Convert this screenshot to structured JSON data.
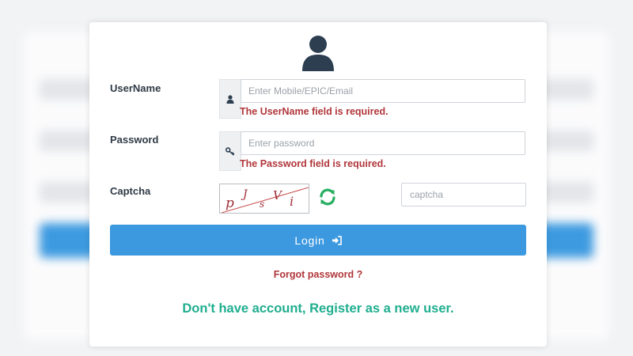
{
  "form": {
    "username_label": "UserName",
    "username_placeholder": "Enter Mobile/EPIC/Email",
    "username_error": "The UserName field is required.",
    "password_label": "Password",
    "password_placeholder": "Enter password",
    "password_error": "The Password field is required.",
    "captcha_label": "Captcha",
    "captcha_chars": [
      "p",
      "J",
      "s",
      "V",
      "i"
    ],
    "captcha_placeholder": "captcha",
    "login_label": "Login",
    "forgot_label": "Forgot password ?",
    "register_label": "Don't have account, Register as a new user."
  },
  "colors": {
    "primary": "#3c98df",
    "error": "#b0363a",
    "success": "#1fae8f",
    "icon": "#2c3e50"
  },
  "icons": {
    "avatar": "user-icon",
    "username_addon": "user-icon",
    "password_addon": "key-icon",
    "refresh": "refresh-icon",
    "login": "sign-in-icon"
  }
}
